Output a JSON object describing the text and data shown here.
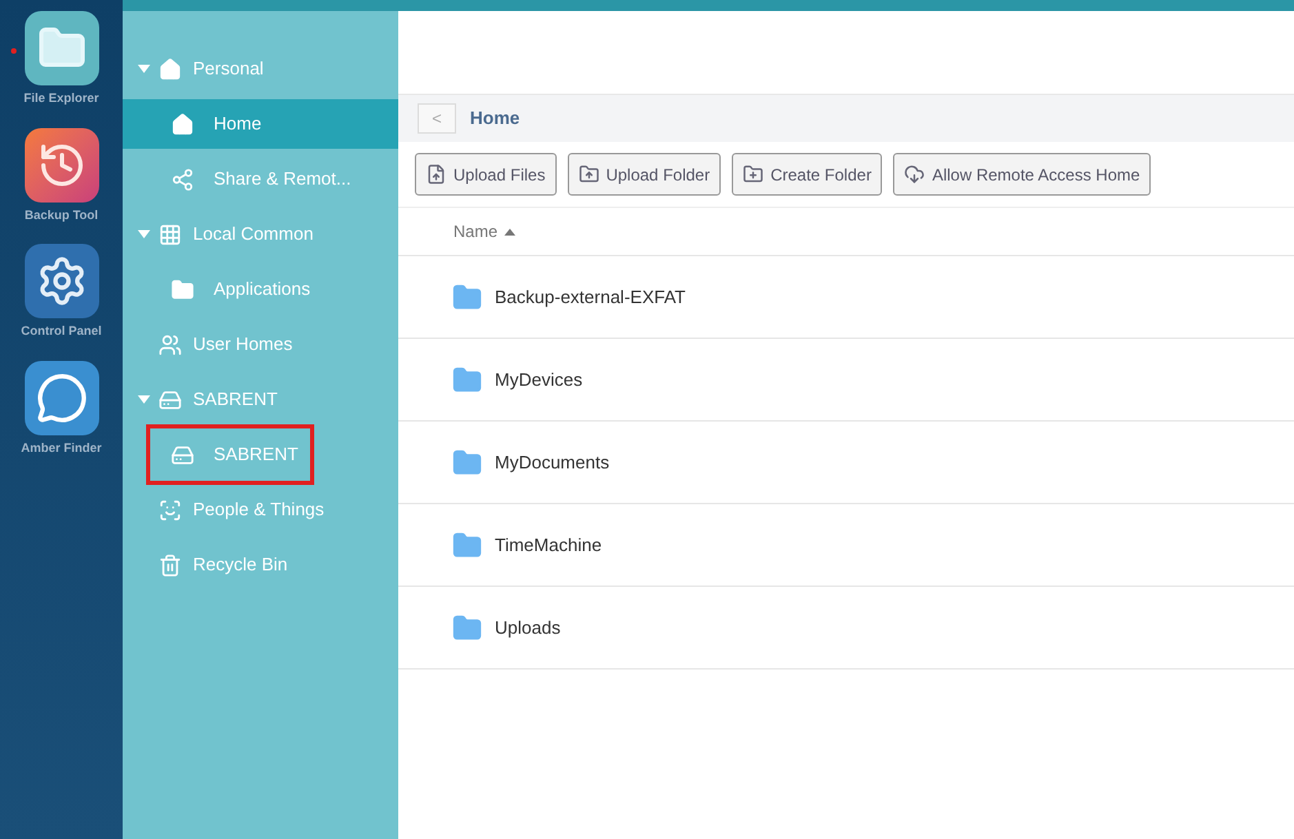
{
  "dock": [
    {
      "name": "File Explorer",
      "kind": "folder",
      "running": true
    },
    {
      "name": "Backup Tool",
      "kind": "backup",
      "running": false
    },
    {
      "name": "Control Panel",
      "kind": "gear",
      "running": false
    },
    {
      "name": "Amber Finder",
      "kind": "finder",
      "running": false
    }
  ],
  "sidebar": {
    "items": [
      {
        "label": "Personal",
        "kind": "home",
        "expanded": true,
        "selected": false,
        "outlined": false,
        "children": [
          {
            "label": "Home",
            "kind": "home",
            "selected": true,
            "outlined": false
          },
          {
            "label": "Share & Remot...",
            "kind": "share",
            "selected": false,
            "outlined": false
          }
        ]
      },
      {
        "label": "Local Common",
        "kind": "apps",
        "expanded": true,
        "selected": false,
        "outlined": false,
        "children": [
          {
            "label": "Applications",
            "kind": "folder",
            "selected": false,
            "outlined": false
          }
        ]
      },
      {
        "label": "User Homes",
        "kind": "users",
        "selected": false,
        "outlined": false
      },
      {
        "label": "SABRENT",
        "kind": "drive",
        "expanded": true,
        "selected": false,
        "outlined": false,
        "children": [
          {
            "label": "SABRENT",
            "kind": "drive",
            "selected": false,
            "outlined": true
          }
        ]
      },
      {
        "label": "People & Things",
        "kind": "faces",
        "selected": false,
        "outlined": false
      },
      {
        "label": "Recycle Bin",
        "kind": "recycle",
        "selected": false,
        "outlined": false
      }
    ]
  },
  "breadcrumb": {
    "back": "<",
    "current": "Home"
  },
  "toolbar": [
    {
      "label": "Upload Files",
      "kind": "upload-file"
    },
    {
      "label": "Upload Folder",
      "kind": "upload-folder"
    },
    {
      "label": "Create Folder",
      "kind": "create-folder"
    },
    {
      "label": "Allow Remote Access Home",
      "kind": "cloud"
    }
  ],
  "table": {
    "columns": [
      {
        "label": "Name",
        "sorted_ascending": true
      }
    ],
    "rows": [
      {
        "name": "Backup-external-EXFAT"
      },
      {
        "name": "MyDevices"
      },
      {
        "name": "MyDocuments"
      },
      {
        "name": "TimeMachine"
      },
      {
        "name": "Uploads"
      }
    ]
  }
}
